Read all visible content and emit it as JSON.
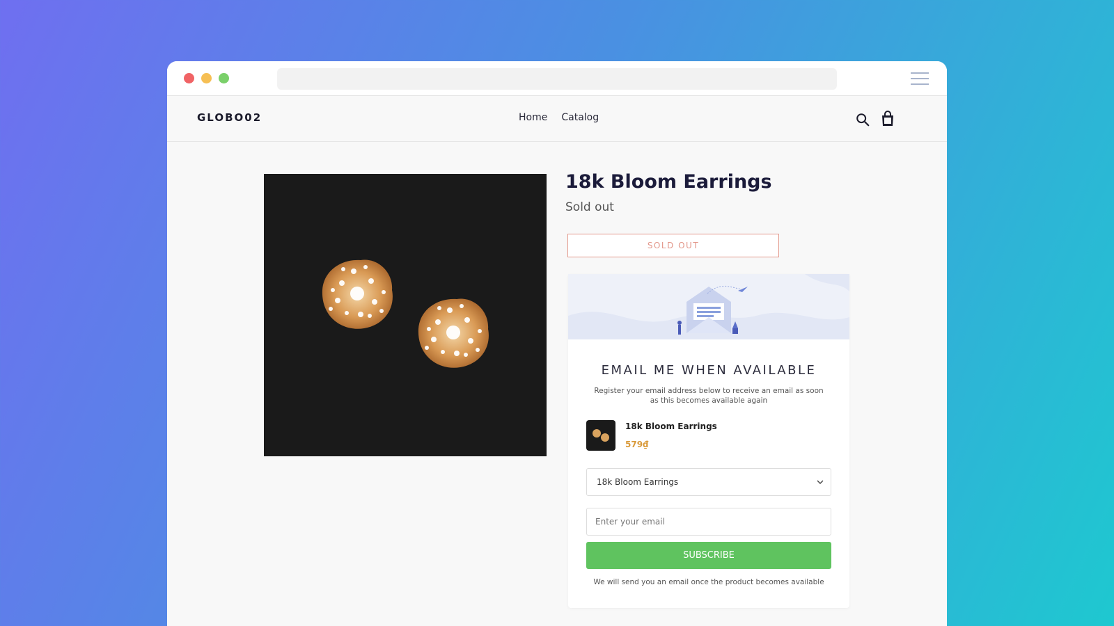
{
  "store": {
    "logo": "GLOBO02",
    "nav": [
      "Home",
      "Catalog"
    ]
  },
  "product": {
    "title": "18k Bloom Earrings",
    "price_status": "Sold out",
    "sold_out_button": "SOLD OUT"
  },
  "notify": {
    "title": "EMAIL ME WHEN AVAILABLE",
    "subtitle": "Register your email address below to receive an email as soon as this becomes available again",
    "product_name": "18k Bloom Earrings",
    "product_price": "579₫",
    "variant_selected": "18k Bloom Earrings",
    "email_placeholder": "Enter your email",
    "subscribe_label": "SUBSCRIBE",
    "footnote": "We will send you an email once the product becomes available"
  },
  "colors": {
    "accent_green": "#5fc35f",
    "sold_out": "#e3988b",
    "price": "#d99a3a"
  }
}
